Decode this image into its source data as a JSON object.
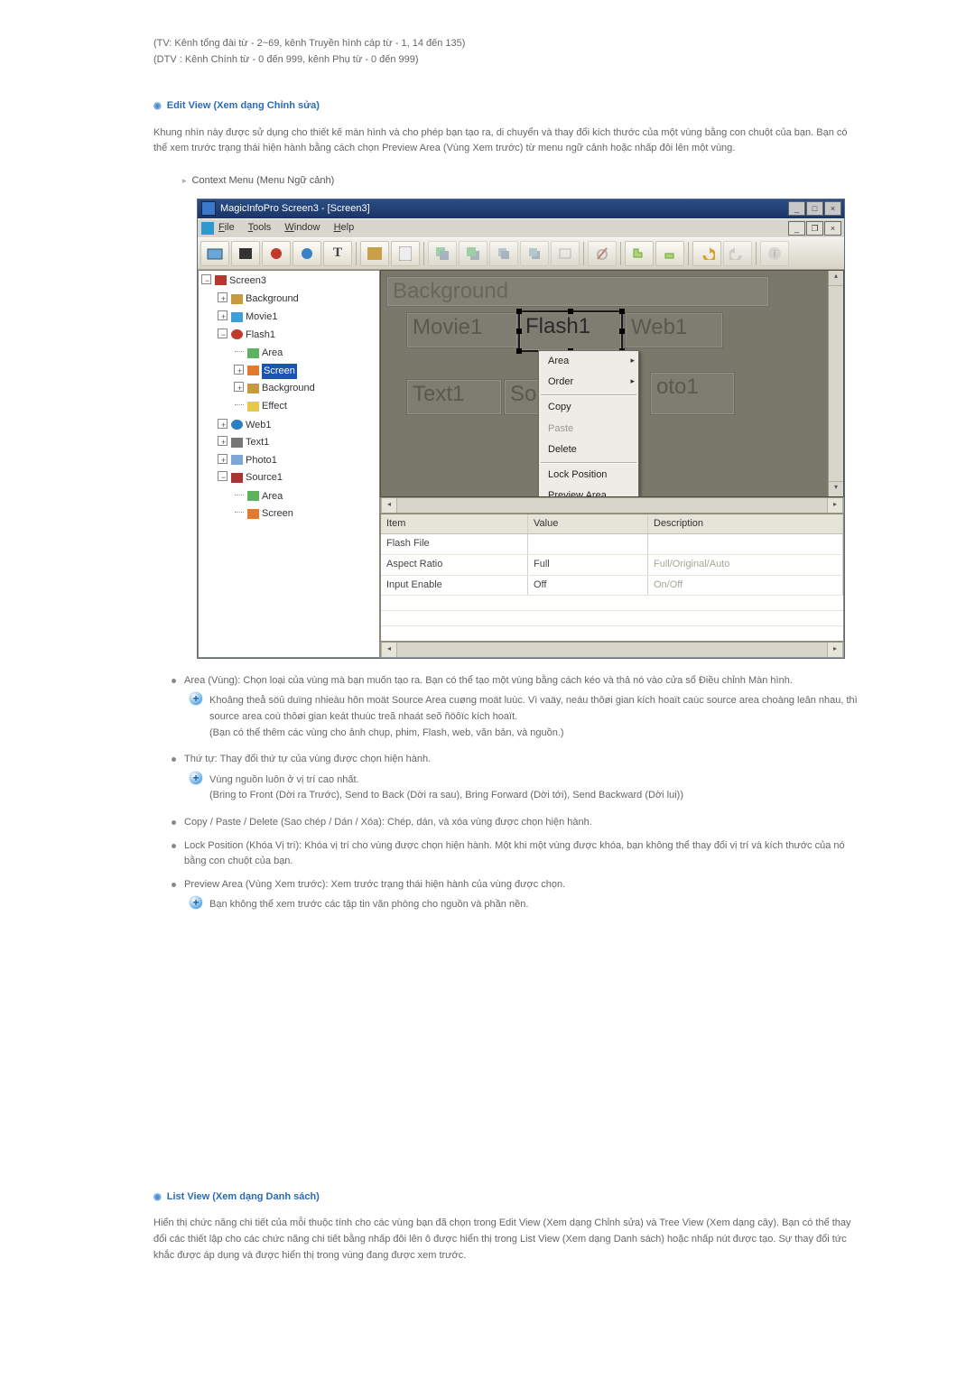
{
  "intro": {
    "tv_line": "(TV: Kênh tổng đài từ - 2~69, kênh Truyền hình cáp từ - 1, 14 đến 135)",
    "dtv_line": "(DTV : Kênh Chính từ - 0 đến 999, kênh Phụ từ - 0 đến 999)"
  },
  "sec_edit": {
    "title": "Edit View (Xem dạng Chỉnh sửa)",
    "desc": "Khung nhìn này được sử dụng cho thiết kế màn hình và cho phép bạn tạo ra, di chuyển và thay đổi kích thước của một vùng bằng con chuột của bạn. Bạn có thể xem trước trạng thái hiện hành bằng cách chọn Preview Area (Vùng Xem trước) từ menu ngữ cảnh hoặc nhấp đôi lên một vùng.",
    "context_menu_heading": "Context Menu (Menu Ngữ cảnh)"
  },
  "shot": {
    "title": "MagicInfoPro Screen3 - [Screen3]",
    "subtitle_menu": {
      "file": "File",
      "tools": "Tools",
      "window": "Window",
      "help": "Help"
    },
    "tree": {
      "root": "Screen3",
      "items": [
        "Background",
        "Movie1",
        "Flash1",
        "Area",
        "Screen",
        "Background",
        "Effect",
        "Web1",
        "Text1",
        "Photo1",
        "Source1",
        "Area",
        "Screen"
      ]
    },
    "regions": {
      "bg": "Background",
      "mov": "Movie1",
      "flash": "Flash1",
      "web": "Web1",
      "txt": "Text1",
      "so": "So",
      "oto": "oto1"
    },
    "ctx": {
      "area": "Area",
      "order": "Order",
      "copy": "Copy",
      "paste": "Paste",
      "delete": "Delete",
      "lock": "Lock Position",
      "preview": "Preview Area"
    },
    "grid": {
      "head_item": "Item",
      "head_value": "Value",
      "head_desc": "Description",
      "rows": [
        {
          "item": "Flash File",
          "value": "",
          "desc": ""
        },
        {
          "item": "Aspect Ratio",
          "value": "Full",
          "desc": "Full/Original/Auto"
        },
        {
          "item": "Input Enable",
          "value": "Off",
          "desc": "On/Off"
        }
      ]
    }
  },
  "bullets": {
    "area": "Area (Vùng): Chọn loại của vùng mà bạn muốn tạo ra. Bạn có thể tạo một vùng bằng cách kéo và thả nó vào cửa sổ Điều chỉnh Màn hình.",
    "area_note1": "Khoâng theå söû duïng nhieàu hôn moät Source Area cuøng moät luùc. Vì vaäy, neáu thôøi gian kích hoaït caùc source area choàng leân nhau, thì source area coù thôøi gian keát thuùc treã nhaát seõ ñöôïc kích hoaït.",
    "area_note1b": "(Bạn có thể thêm các vùng cho ảnh chụp, phim, Flash, web, văn bản, và nguồn.)",
    "order": "Thứ tự: Thay đổi thứ tự của vùng được chọn hiện hành.",
    "order_note1": "Vùng nguồn luôn ở vị trí cao nhất.",
    "order_note1b": "(Bring to Front (Dời ra Trước), Send to Back (Dời ra sau), Bring Forward (Dời tới), Send Backward (Dời lui))",
    "copy": "Copy / Paste / Delete (Sao chép / Dán / Xóa): Chép, dán, và xóa vùng được chọn hiện hành.",
    "lock": "Lock Position (Khóa Vị trí): Khóa vị trí cho vùng được chọn hiện hành. Một khi một vùng được khóa, bạn không thể thay đổi vị trí và kích thước của nó bằng con chuột của bạn.",
    "preview": "Preview Area (Vùng Xem trước): Xem trước trạng thái hiện hành của vùng được chọn.",
    "preview_note1": "Bạn không thể xem trước các tập tin văn phòng cho nguồn và phần nền."
  },
  "sec_list": {
    "title": "List View (Xem dạng Danh sách)",
    "desc": "Hiển thị chức năng chi tiết của mỗi thuộc tính cho các vùng bạn đã chọn trong Edit View (Xem dạng Chỉnh sửa) và Tree View (Xem dạng cây). Bạn có thể thay đổi các thiết lập cho các chức năng chi tiết bằng nhấp đôi lên ô được hiển thị trong List View (Xem dạng Danh sách) hoặc nhấp nút được tạo. Sự thay đổi tức khắc được áp dụng và được hiển thị trong vùng đang được xem trước."
  }
}
